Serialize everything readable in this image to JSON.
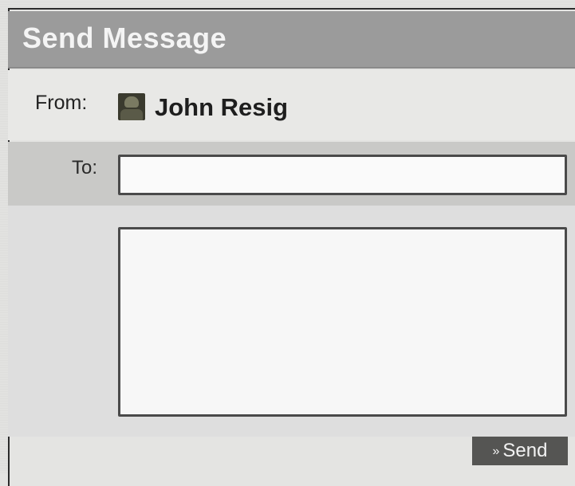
{
  "dialog": {
    "title": "Send Message"
  },
  "from": {
    "label": "From:",
    "name": "John Resig",
    "avatar_icon": "user-avatar"
  },
  "to": {
    "label": "To:",
    "value": ""
  },
  "message": {
    "value": ""
  },
  "actions": {
    "send_arrow": "»",
    "send_label": "Send"
  },
  "colors": {
    "title_bar": "#9b9b9b",
    "title_text": "#f4f4f4",
    "to_row": "#c9c9c7",
    "send_button": "#555553"
  }
}
